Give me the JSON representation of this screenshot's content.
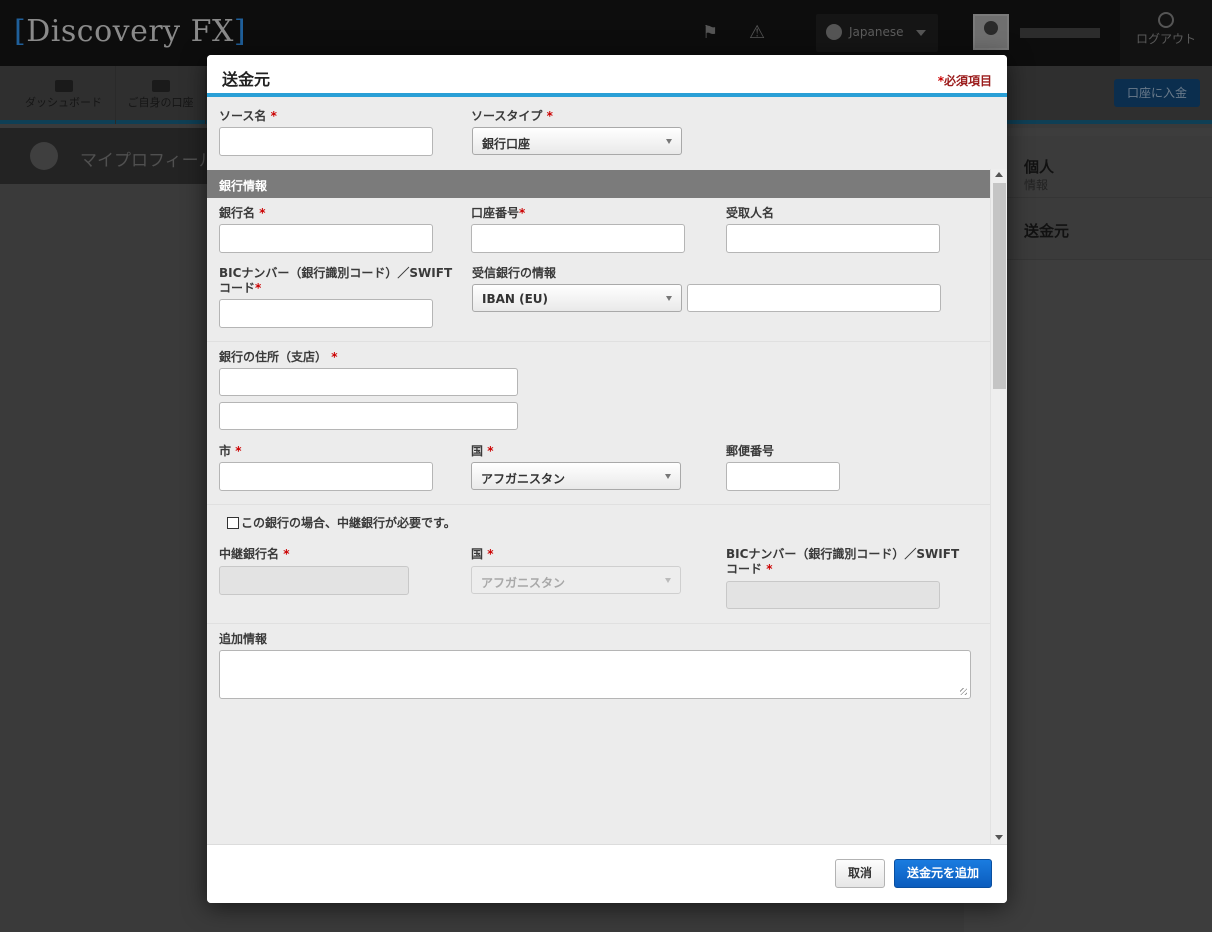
{
  "app": {
    "logo": "Discovery FX",
    "language": "Japanese",
    "logout_label": "ログアウト",
    "nav": [
      {
        "label": "ダッシュボード",
        "icon": "speedometer-icon"
      },
      {
        "label": "ご自身の口座",
        "icon": "bar-chart-icon"
      }
    ],
    "deposit_label": "口座に入金",
    "subheader_title": "マイプロフィール",
    "side": [
      {
        "title": "個人",
        "subtitle": "情報"
      },
      {
        "title": "送金元",
        "subtitle": ""
      }
    ]
  },
  "modal": {
    "title": "送金元",
    "required_note": "必須項目",
    "required_star": "*",
    "source_name": {
      "label": "ソース名",
      "value": ""
    },
    "source_type": {
      "label": "ソースタイプ",
      "value": "銀行口座"
    },
    "bank_section_title": "銀行情報",
    "bank_name": {
      "label": "銀行名",
      "value": ""
    },
    "account_number": {
      "label": "口座番号",
      "value": ""
    },
    "recipient_name": {
      "label": "受取人名",
      "value": ""
    },
    "bic": {
      "label_line1": "BICナンバー（銀行識別コード）／SWIFT",
      "label_line2": "コード",
      "value": ""
    },
    "receiving_bank": {
      "label": "受信銀行の情報",
      "select_value": "IBAN (EU)",
      "value": ""
    },
    "bank_address": {
      "label": "銀行の住所（支店）",
      "line1": "",
      "line2": ""
    },
    "city": {
      "label": "市",
      "value": ""
    },
    "country": {
      "label": "国",
      "value": "アフガニスタン"
    },
    "postal_code": {
      "label": "郵便番号",
      "value": ""
    },
    "intermediary_checkbox": {
      "label": "この銀行の場合、中継銀行が必要です。",
      "checked": false
    },
    "intermediary_name": {
      "label": "中継銀行名",
      "value": ""
    },
    "intermediary_country": {
      "label": "国",
      "value": "アフガニスタン"
    },
    "intermediary_bic": {
      "label_line1": "BICナンバー（銀行識別コード）／SWIFT",
      "label_line2": "コード",
      "value": ""
    },
    "additional_info": {
      "label": "追加情報",
      "value": ""
    },
    "cancel_label": "取消",
    "submit_label": "送金元を追加"
  },
  "colors": {
    "accent": "#2a9fd6",
    "primary_button": "#0b5cbd",
    "required": "#cc0000",
    "section_bar": "#7b7b7b"
  }
}
